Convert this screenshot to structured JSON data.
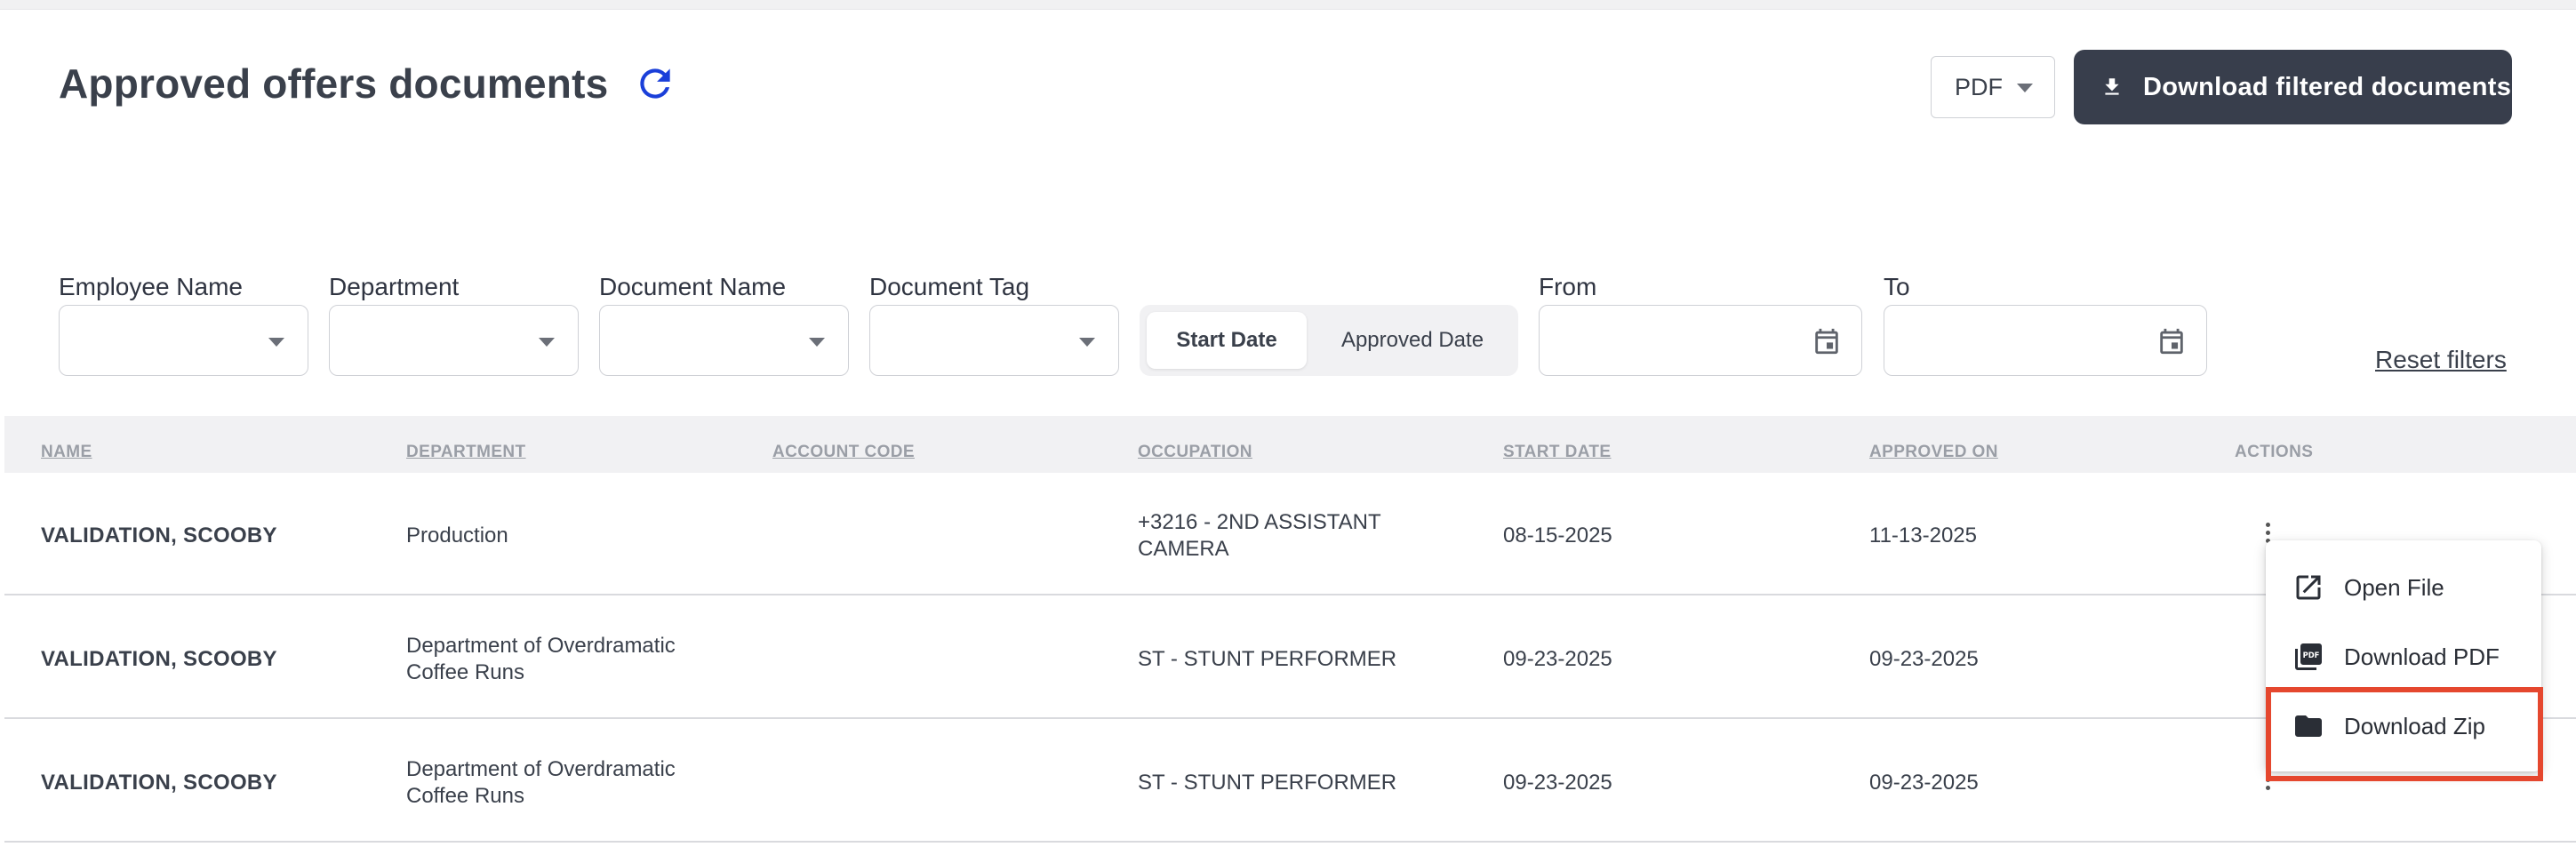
{
  "header": {
    "title": "Approved offers documents",
    "format_value": "PDF",
    "download_label": "Download filtered documents"
  },
  "filters": {
    "employee_name_label": "Employee Name",
    "department_label": "Department",
    "document_name_label": "Document Name",
    "document_tag_label": "Document Tag",
    "date_toggle": {
      "active": "Start Date",
      "other": "Approved Date"
    },
    "from_label": "From",
    "to_label": "To",
    "reset_label": "Reset filters"
  },
  "table": {
    "columns": [
      "NAME",
      "DEPARTMENT",
      "ACCOUNT CODE",
      "OCCUPATION",
      "START DATE",
      "APPROVED ON",
      "ACTIONS"
    ],
    "rows": [
      {
        "name": "VALIDATION, SCOOBY",
        "department_line1": "Production",
        "department_line2": "",
        "account_code": "",
        "occupation_line1": "+3216 - 2ND ASSISTANT",
        "occupation_line2": "CAMERA",
        "start_date": "08-15-2025",
        "approved_on": "11-13-2025"
      },
      {
        "name": "VALIDATION, SCOOBY",
        "department_line1": "Department of Overdramatic",
        "department_line2": "Coffee Runs",
        "account_code": "",
        "occupation_line1": "ST - STUNT PERFORMER",
        "occupation_line2": "",
        "start_date": "09-23-2025",
        "approved_on": "09-23-2025"
      },
      {
        "name": "VALIDATION, SCOOBY",
        "department_line1": "Department of Overdramatic",
        "department_line2": "Coffee Runs",
        "account_code": "",
        "occupation_line1": "ST - STUNT PERFORMER",
        "occupation_line2": "",
        "start_date": "09-23-2025",
        "approved_on": "09-23-2025"
      }
    ]
  },
  "actions_menu": {
    "items": [
      "Open File",
      "Download PDF",
      "Download Zip"
    ],
    "highlighted_item": "Download Zip",
    "highlight_color": "#e5472e"
  },
  "colors": {
    "primary_button": "#383e4c",
    "refresh_icon": "#1a3fd9"
  }
}
